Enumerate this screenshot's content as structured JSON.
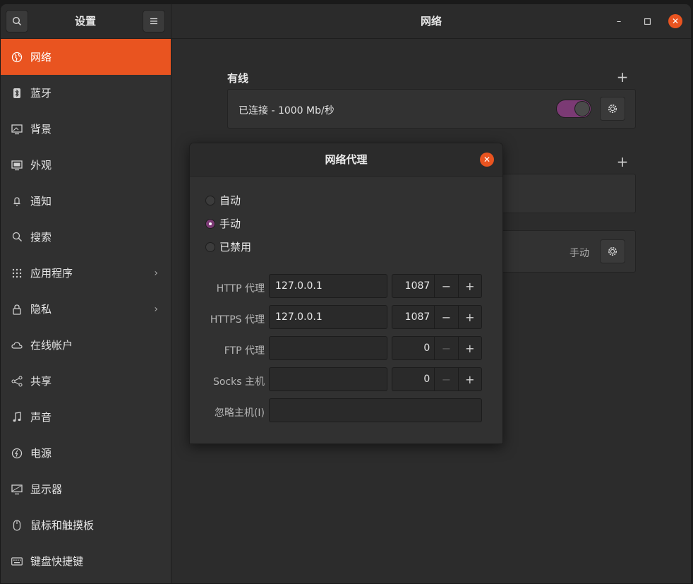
{
  "window": {
    "sidebar_title": "设置",
    "main_title": "网络",
    "minimize_glyph": "–",
    "maximize_glyph": "□",
    "close_glyph": "✕"
  },
  "sidebar": {
    "items": [
      {
        "label": "网络",
        "icon": "network-icon",
        "active": true
      },
      {
        "label": "蓝牙",
        "icon": "bluetooth-icon"
      },
      {
        "label": "背景",
        "icon": "background-icon"
      },
      {
        "label": "外观",
        "icon": "appearance-icon"
      },
      {
        "label": "通知",
        "icon": "bell-icon"
      },
      {
        "label": "搜索",
        "icon": "search-icon"
      },
      {
        "label": "应用程序",
        "icon": "apps-grid-icon",
        "chevron": "›"
      },
      {
        "label": "隐私",
        "icon": "lock-icon",
        "chevron": "›"
      },
      {
        "label": "在线帐户",
        "icon": "cloud-icon"
      },
      {
        "label": "共享",
        "icon": "share-icon"
      },
      {
        "label": "声音",
        "icon": "music-note-icon"
      },
      {
        "label": "电源",
        "icon": "power-icon"
      },
      {
        "label": "显示器",
        "icon": "display-icon"
      },
      {
        "label": "鼠标和触摸板",
        "icon": "mouse-icon"
      },
      {
        "label": "键盘快捷键",
        "icon": "keyboard-icon"
      }
    ]
  },
  "network": {
    "wired_title": "有线",
    "wired_status": "已连接 - 1000 Mb/秒",
    "wired_enabled": true,
    "add_glyph": "+",
    "proxy_mode_value": "手动"
  },
  "proxy_dialog": {
    "title": "网络代理",
    "modes": [
      "自动",
      "手动",
      "已禁用"
    ],
    "selected_mode": "手动",
    "fields": {
      "http": {
        "label": "HTTP 代理",
        "host": "127.0.0.1",
        "port": "1087"
      },
      "https": {
        "label": "HTTPS 代理",
        "host": "127.0.0.1",
        "port": "1087"
      },
      "ftp": {
        "label": "FTP 代理",
        "host": "",
        "port": "0"
      },
      "socks": {
        "label": "Socks 主机",
        "host": "",
        "port": "0"
      },
      "ignore": {
        "label": "忽略主机(I)",
        "value": ""
      }
    },
    "minus_glyph": "−",
    "plus_glyph": "+"
  },
  "colors": {
    "accent": "#e95420",
    "toggle_on": "#7b3a74",
    "window_bg": "#2c2c2c",
    "sidebar_bg": "#303030"
  }
}
